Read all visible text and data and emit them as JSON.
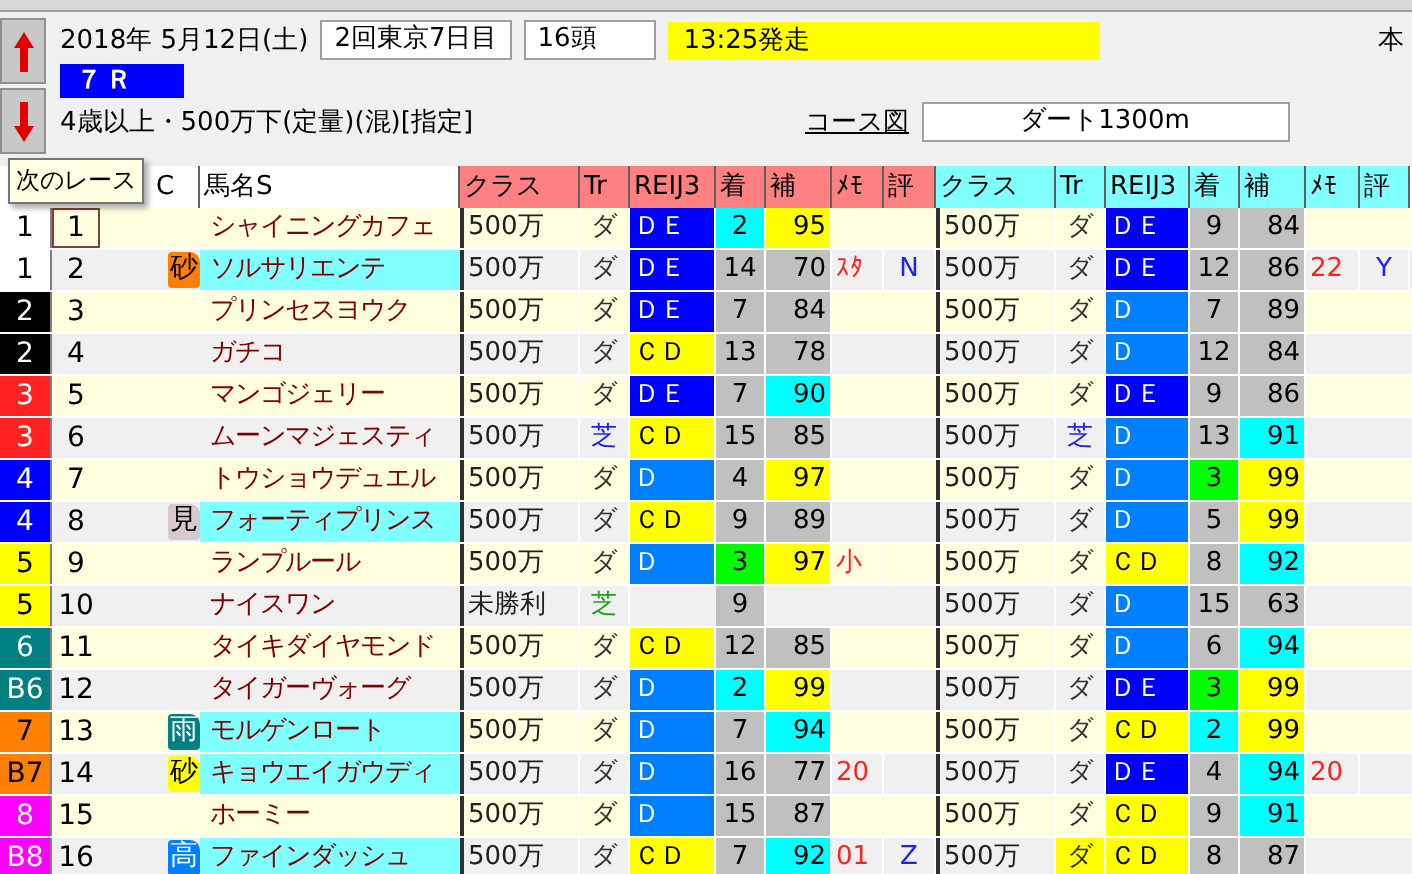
{
  "race": {
    "date": "2018年  5月12日(土)",
    "meeting": "2回東京7日目",
    "runners": "16頭",
    "start_time": "13:25発走",
    "corner": "本",
    "race_number": "７Ｒ",
    "conditions": "4歳以上・500万下(定量)(混)[指定]",
    "course_link": "コース図",
    "course": "ダート1300m"
  },
  "tooltip": "次のレース",
  "columns": [
    "C",
    "馬名S"
  ],
  "past_groups": [
    {
      "color": "#ff8080",
      "labels": [
        "クラス",
        "Tr",
        "REIJ3",
        "着",
        "補",
        "ﾒﾓ",
        "評"
      ]
    },
    {
      "color": "#80ffff",
      "labels": [
        "クラス",
        "Tr",
        "REIJ3",
        "着",
        "補",
        "ﾒﾓ",
        "評"
      ]
    }
  ],
  "rows": [
    {
      "frame": {
        "text": "1",
        "color": "#ffffff"
      },
      "number": "1",
      "name": "シャイニングカフェ",
      "highlighted": false,
      "past": [
        {
          "class": "500万",
          "track": {
            "text": "ダ",
            "color": "#303030",
            "highlighted": false
          },
          "red3": {
            "text": "ＤＥ",
            "color": "#0000ff"
          },
          "finish": {
            "text": "2",
            "color": "#00ffff"
          },
          "rating": {
            "text": "95",
            "color": "#ffff00"
          }
        },
        {
          "class": "500万",
          "track": {
            "text": "ダ",
            "color": "#303030",
            "highlighted": false
          },
          "red3": {
            "text": "ＤＥ",
            "color": "#0000ff"
          },
          "finish": {
            "text": "9",
            "color": "#c0c0c0"
          },
          "rating": {
            "text": "84",
            "color": "#c0c0c0"
          }
        }
      ]
    },
    {
      "frame": {
        "text": "1",
        "color": "#ffffff"
      },
      "number": "2",
      "mark": {
        "text": "砂",
        "color": "#ff8000"
      },
      "name": "ソルサリエンテ",
      "highlighted": true,
      "past": [
        {
          "class": "500万",
          "track": {
            "text": "ダ",
            "color": "#303030",
            "highlighted": false
          },
          "red3": {
            "text": "ＤＥ",
            "color": "#0000ff"
          },
          "finish": {
            "text": "14",
            "color": "#c0c0c0"
          },
          "rating": {
            "text": "70",
            "color": "#c0c0c0"
          },
          "memo": "ｽﾀ",
          "eval": "N"
        },
        {
          "class": "500万",
          "track": {
            "text": "ダ",
            "color": "#303030",
            "highlighted": false
          },
          "red3": {
            "text": "ＤＥ",
            "color": "#0000ff"
          },
          "finish": {
            "text": "12",
            "color": "#c0c0c0"
          },
          "rating": {
            "text": "86",
            "color": "#c0c0c0"
          },
          "memo": "22",
          "eval": "Y"
        }
      ]
    },
    {
      "frame": {
        "text": "2",
        "color": "#000000"
      },
      "number": "3",
      "name": "プリンセスヨウク",
      "highlighted": false,
      "past": [
        {
          "class": "500万",
          "track": {
            "text": "ダ",
            "color": "#303030",
            "highlighted": false
          },
          "red3": {
            "text": "ＤＥ",
            "color": "#0000ff"
          },
          "finish": {
            "text": "7",
            "color": "#c0c0c0"
          },
          "rating": {
            "text": "84",
            "color": "#c0c0c0"
          }
        },
        {
          "class": "500万",
          "track": {
            "text": "ダ",
            "color": "#303030",
            "highlighted": false
          },
          "red3": {
            "text": "Ｄ",
            "color": "#0080ff"
          },
          "finish": {
            "text": "7",
            "color": "#c0c0c0"
          },
          "rating": {
            "text": "89",
            "color": "#c0c0c0"
          }
        }
      ]
    },
    {
      "frame": {
        "text": "2",
        "color": "#000000"
      },
      "number": "4",
      "name": "ガチコ",
      "highlighted": false,
      "past": [
        {
          "class": "500万",
          "track": {
            "text": "ダ",
            "color": "#303030",
            "highlighted": false
          },
          "red3": {
            "text": "ＣＤ",
            "color": "#ffff00"
          },
          "finish": {
            "text": "13",
            "color": "#c0c0c0"
          },
          "rating": {
            "text": "78",
            "color": "#c0c0c0"
          }
        },
        {
          "class": "500万",
          "track": {
            "text": "ダ",
            "color": "#303030",
            "highlighted": false
          },
          "red3": {
            "text": "Ｄ",
            "color": "#0080ff"
          },
          "finish": {
            "text": "12",
            "color": "#c0c0c0"
          },
          "rating": {
            "text": "84",
            "color": "#c0c0c0"
          }
        }
      ]
    },
    {
      "frame": {
        "text": "3",
        "color": "#ff2020"
      },
      "number": "5",
      "name": "マンゴジェリー",
      "highlighted": false,
      "past": [
        {
          "class": "500万",
          "track": {
            "text": "ダ",
            "color": "#303030",
            "highlighted": false
          },
          "red3": {
            "text": "ＤＥ",
            "color": "#0000ff"
          },
          "finish": {
            "text": "7",
            "color": "#c0c0c0"
          },
          "rating": {
            "text": "90",
            "color": "#00ffff"
          }
        },
        {
          "class": "500万",
          "track": {
            "text": "ダ",
            "color": "#303030",
            "highlighted": false
          },
          "red3": {
            "text": "ＤＥ",
            "color": "#0000ff"
          },
          "finish": {
            "text": "9",
            "color": "#c0c0c0"
          },
          "rating": {
            "text": "86",
            "color": "#c0c0c0"
          }
        }
      ]
    },
    {
      "frame": {
        "text": "3",
        "color": "#ff2020"
      },
      "number": "6",
      "name": "ムーンマジェスティ",
      "highlighted": false,
      "past": [
        {
          "class": "500万",
          "track": {
            "text": "芝",
            "color": "#2020ff",
            "highlighted": false
          },
          "red3": {
            "text": "ＣＤ",
            "color": "#ffff00"
          },
          "finish": {
            "text": "15",
            "color": "#c0c0c0"
          },
          "rating": {
            "text": "85",
            "color": "#c0c0c0"
          }
        },
        {
          "class": "500万",
          "track": {
            "text": "芝",
            "color": "#2020ff",
            "highlighted": false
          },
          "red3": {
            "text": "Ｄ",
            "color": "#0080ff"
          },
          "finish": {
            "text": "13",
            "color": "#c0c0c0"
          },
          "rating": {
            "text": "91",
            "color": "#00ffff"
          }
        }
      ]
    },
    {
      "frame": {
        "text": "4",
        "color": "#0000ff"
      },
      "number": "7",
      "name": "トウショウデュエル",
      "highlighted": false,
      "past": [
        {
          "class": "500万",
          "track": {
            "text": "ダ",
            "color": "#303030",
            "highlighted": false
          },
          "red3": {
            "text": "Ｄ",
            "color": "#0080ff"
          },
          "finish": {
            "text": "4",
            "color": "#c0c0c0"
          },
          "rating": {
            "text": "97",
            "color": "#ffff00"
          }
        },
        {
          "class": "500万",
          "track": {
            "text": "ダ",
            "color": "#303030",
            "highlighted": false
          },
          "red3": {
            "text": "Ｄ",
            "color": "#0080ff"
          },
          "finish": {
            "text": "3",
            "color": "#00ff00"
          },
          "rating": {
            "text": "99",
            "color": "#ffff00"
          }
        }
      ]
    },
    {
      "frame": {
        "text": "4",
        "color": "#0000ff"
      },
      "number": "8",
      "mark": {
        "text": "見",
        "color": "#d8c8d0"
      },
      "name": "フォーティプリンス",
      "highlighted": true,
      "past": [
        {
          "class": "500万",
          "track": {
            "text": "ダ",
            "color": "#303030",
            "highlighted": false
          },
          "red3": {
            "text": "ＣＤ",
            "color": "#ffff00"
          },
          "finish": {
            "text": "9",
            "color": "#c0c0c0"
          },
          "rating": {
            "text": "89",
            "color": "#c0c0c0"
          }
        },
        {
          "class": "500万",
          "track": {
            "text": "ダ",
            "color": "#303030",
            "highlighted": false
          },
          "red3": {
            "text": "Ｄ",
            "color": "#0080ff"
          },
          "finish": {
            "text": "5",
            "color": "#c0c0c0"
          },
          "rating": {
            "text": "99",
            "color": "#ffff00"
          }
        }
      ]
    },
    {
      "frame": {
        "text": "5",
        "color": "#ffff00"
      },
      "number": "9",
      "name": "ランプルール",
      "highlighted": false,
      "past": [
        {
          "class": "500万",
          "track": {
            "text": "ダ",
            "color": "#303030",
            "highlighted": false
          },
          "red3": {
            "text": "Ｄ",
            "color": "#0080ff"
          },
          "finish": {
            "text": "3",
            "color": "#00ff00"
          },
          "rating": {
            "text": "97",
            "color": "#ffff00"
          },
          "memo": "小"
        },
        {
          "class": "500万",
          "track": {
            "text": "ダ",
            "color": "#303030",
            "highlighted": false
          },
          "red3": {
            "text": "ＣＤ",
            "color": "#ffff00"
          },
          "finish": {
            "text": "8",
            "color": "#c0c0c0"
          },
          "rating": {
            "text": "92",
            "color": "#00ffff"
          }
        }
      ]
    },
    {
      "frame": {
        "text": "5",
        "color": "#ffff00"
      },
      "number": "10",
      "name": "ナイスワン",
      "highlighted": false,
      "past": [
        {
          "class": "未勝利",
          "track": {
            "text": "芝",
            "color": "#20a020",
            "highlighted": false
          },
          "finish": {
            "text": "9",
            "color": "#c0c0c0"
          }
        },
        {
          "class": "500万",
          "track": {
            "text": "ダ",
            "color": "#303030",
            "highlighted": false
          },
          "red3": {
            "text": "Ｄ",
            "color": "#0080ff"
          },
          "finish": {
            "text": "15",
            "color": "#c0c0c0"
          },
          "rating": {
            "text": "63",
            "color": "#c0c0c0"
          }
        }
      ]
    },
    {
      "frame": {
        "text": "6",
        "color": "#008080"
      },
      "number": "11",
      "name": "タイキダイヤモンド",
      "highlighted": false,
      "past": [
        {
          "class": "500万",
          "track": {
            "text": "ダ",
            "color": "#303030",
            "highlighted": false
          },
          "red3": {
            "text": "ＣＤ",
            "color": "#ffff00"
          },
          "finish": {
            "text": "12",
            "color": "#c0c0c0"
          },
          "rating": {
            "text": "85",
            "color": "#c0c0c0"
          }
        },
        {
          "class": "500万",
          "track": {
            "text": "ダ",
            "color": "#303030",
            "highlighted": false
          },
          "red3": {
            "text": "Ｄ",
            "color": "#0080ff"
          },
          "finish": {
            "text": "6",
            "color": "#c0c0c0"
          },
          "rating": {
            "text": "94",
            "color": "#00ffff"
          }
        }
      ]
    },
    {
      "frame": {
        "text": "B6",
        "color": "#008080"
      },
      "number": "12",
      "name": "タイガーヴォーグ",
      "highlighted": false,
      "past": [
        {
          "class": "500万",
          "track": {
            "text": "ダ",
            "color": "#303030",
            "highlighted": false
          },
          "red3": {
            "text": "Ｄ",
            "color": "#0080ff"
          },
          "finish": {
            "text": "2",
            "color": "#00ffff"
          },
          "rating": {
            "text": "99",
            "color": "#ffff00"
          }
        },
        {
          "class": "500万",
          "track": {
            "text": "ダ",
            "color": "#303030",
            "highlighted": false
          },
          "red3": {
            "text": "ＤＥ",
            "color": "#0000ff"
          },
          "finish": {
            "text": "3",
            "color": "#00ff00"
          },
          "rating": {
            "text": "99",
            "color": "#ffff00"
          }
        }
      ]
    },
    {
      "frame": {
        "text": "7",
        "color": "#ff8000"
      },
      "number": "13",
      "mark": {
        "text": "雨",
        "color": "#008080"
      },
      "name": "モルゲンロート",
      "highlighted": true,
      "past": [
        {
          "class": "500万",
          "track": {
            "text": "ダ",
            "color": "#303030",
            "highlighted": false
          },
          "red3": {
            "text": "Ｄ",
            "color": "#0080ff"
          },
          "finish": {
            "text": "7",
            "color": "#c0c0c0"
          },
          "rating": {
            "text": "94",
            "color": "#00ffff"
          }
        },
        {
          "class": "500万",
          "track": {
            "text": "ダ",
            "color": "#303030",
            "highlighted": false
          },
          "red3": {
            "text": "ＣＤ",
            "color": "#ffff00"
          },
          "finish": {
            "text": "2",
            "color": "#00ffff"
          },
          "rating": {
            "text": "99",
            "color": "#ffff00"
          }
        }
      ]
    },
    {
      "frame": {
        "text": "B7",
        "color": "#ff8000"
      },
      "number": "14",
      "mark": {
        "text": "砂",
        "color": "#ffff00"
      },
      "name": "キョウエイガウディ",
      "highlighted": true,
      "past": [
        {
          "class": "500万",
          "track": {
            "text": "ダ",
            "color": "#303030",
            "highlighted": false
          },
          "red3": {
            "text": "Ｄ",
            "color": "#0080ff"
          },
          "finish": {
            "text": "16",
            "color": "#c0c0c0"
          },
          "rating": {
            "text": "77",
            "color": "#c0c0c0"
          },
          "memo": "20"
        },
        {
          "class": "500万",
          "track": {
            "text": "ダ",
            "color": "#303030",
            "highlighted": false
          },
          "red3": {
            "text": "ＤＥ",
            "color": "#0000ff"
          },
          "finish": {
            "text": "4",
            "color": "#c0c0c0"
          },
          "rating": {
            "text": "94",
            "color": "#00ffff"
          },
          "memo": "20"
        }
      ]
    },
    {
      "frame": {
        "text": "8",
        "color": "#ff00ff"
      },
      "number": "15",
      "name": "ホーミー",
      "highlighted": false,
      "past": [
        {
          "class": "500万",
          "track": {
            "text": "ダ",
            "color": "#303030",
            "highlighted": false
          },
          "red3": {
            "text": "Ｄ",
            "color": "#0080ff"
          },
          "finish": {
            "text": "15",
            "color": "#c0c0c0"
          },
          "rating": {
            "text": "87",
            "color": "#c0c0c0"
          }
        },
        {
          "class": "500万",
          "track": {
            "text": "ダ",
            "color": "#303030",
            "highlighted": false
          },
          "red3": {
            "text": "ＣＤ",
            "color": "#ffff00"
          },
          "finish": {
            "text": "9",
            "color": "#c0c0c0"
          },
          "rating": {
            "text": "91",
            "color": "#00ffff"
          }
        }
      ]
    },
    {
      "frame": {
        "text": "B8",
        "color": "#ff00ff"
      },
      "number": "16",
      "mark": {
        "text": "高",
        "color": "#0080ff"
      },
      "name": "ファインダッシュ",
      "highlighted": true,
      "past": [
        {
          "class": "500万",
          "track": {
            "text": "ダ",
            "color": "#303030",
            "highlighted": false
          },
          "red3": {
            "text": "ＣＤ",
            "color": "#ffff00"
          },
          "finish": {
            "text": "7",
            "color": "#c0c0c0"
          },
          "rating": {
            "text": "92",
            "color": "#00ffff"
          },
          "memo": "01",
          "eval": "Z"
        },
        {
          "class": "500万",
          "track": {
            "text": "ダ",
            "color": "#303030",
            "highlighted": true
          },
          "red3": {
            "text": "ＣＤ",
            "color": "#ffff00"
          },
          "finish": {
            "text": "8",
            "color": "#c0c0c0"
          },
          "rating": {
            "text": "87",
            "color": "#c0c0c0"
          }
        }
      ]
    }
  ]
}
